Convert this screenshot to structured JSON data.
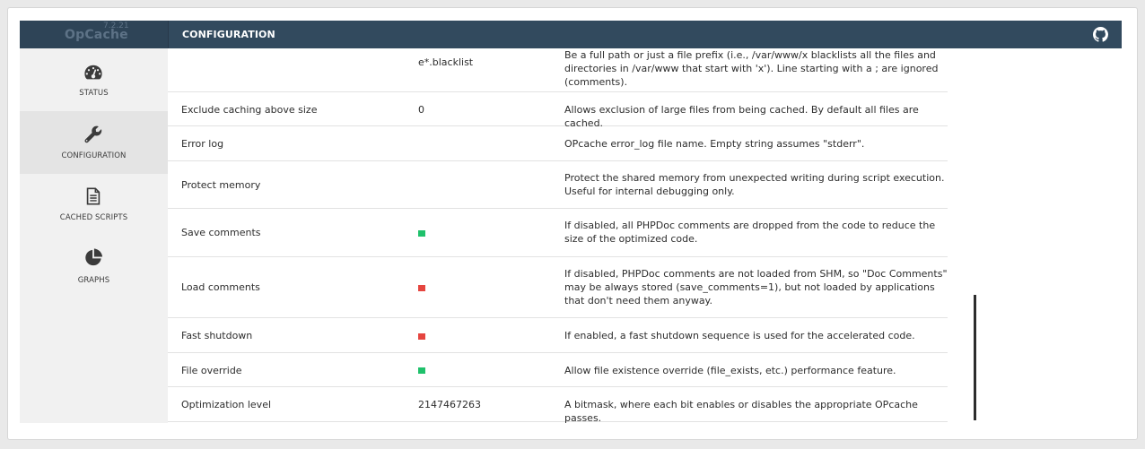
{
  "app": {
    "name": "OpCache",
    "version": "7.2.21",
    "section_title": "CONFIGURATION",
    "github_icon": "github-icon"
  },
  "sidebar": {
    "items": [
      {
        "label": "STATUS",
        "icon": "dashboard-gauge-icon",
        "active": false
      },
      {
        "label": "CONFIGURATION",
        "icon": "wrench-icon",
        "active": true
      },
      {
        "label": "CACHED SCRIPTS",
        "icon": "document-icon",
        "active": false
      },
      {
        "label": "GRAPHS",
        "icon": "pie-chart-icon",
        "active": false
      }
    ]
  },
  "config": {
    "rows": [
      {
        "name": "",
        "value": "e*.blacklist",
        "desc": "Be a full path or just a file prefix (i.e., /var/www/x blacklists all the files and directories in /var/www that start with 'x'). Line starting with a ; are ignored (comments)."
      },
      {
        "name": "Exclude caching above size",
        "value": "0",
        "desc": "Allows exclusion of large files from being cached. By default all files are cached."
      },
      {
        "name": "Error log",
        "value": "",
        "desc": "OPcache error_log file name. Empty string assumes \"stderr\"."
      },
      {
        "name": "Protect memory",
        "value": "",
        "desc": "Protect the shared memory from unexpected writing during script execution. Useful for internal debugging only."
      },
      {
        "name": "Save comments",
        "state": "on",
        "desc": "If disabled, all PHPDoc comments are dropped from the code to reduce the size of the optimized code."
      },
      {
        "name": "Load comments",
        "state": "off",
        "desc": "If disabled, PHPDoc comments are not loaded from SHM, so \"Doc Comments\" may be always stored (save_comments=1), but not loaded by applications that don't need them anyway."
      },
      {
        "name": "Fast shutdown",
        "state": "off",
        "desc": "If enabled, a fast shutdown sequence is used for the accelerated code."
      },
      {
        "name": "File override",
        "state": "on",
        "desc": "Allow file existence override (file_exists, etc.) performance feature."
      },
      {
        "name": "Optimization level",
        "value": "2147467263",
        "desc": "A bitmask, where each bit enables or disables the appropriate OPcache passes."
      }
    ]
  },
  "colors": {
    "header": "#324a5e",
    "enabled": "#1fc16b",
    "disabled": "#e5453f"
  }
}
